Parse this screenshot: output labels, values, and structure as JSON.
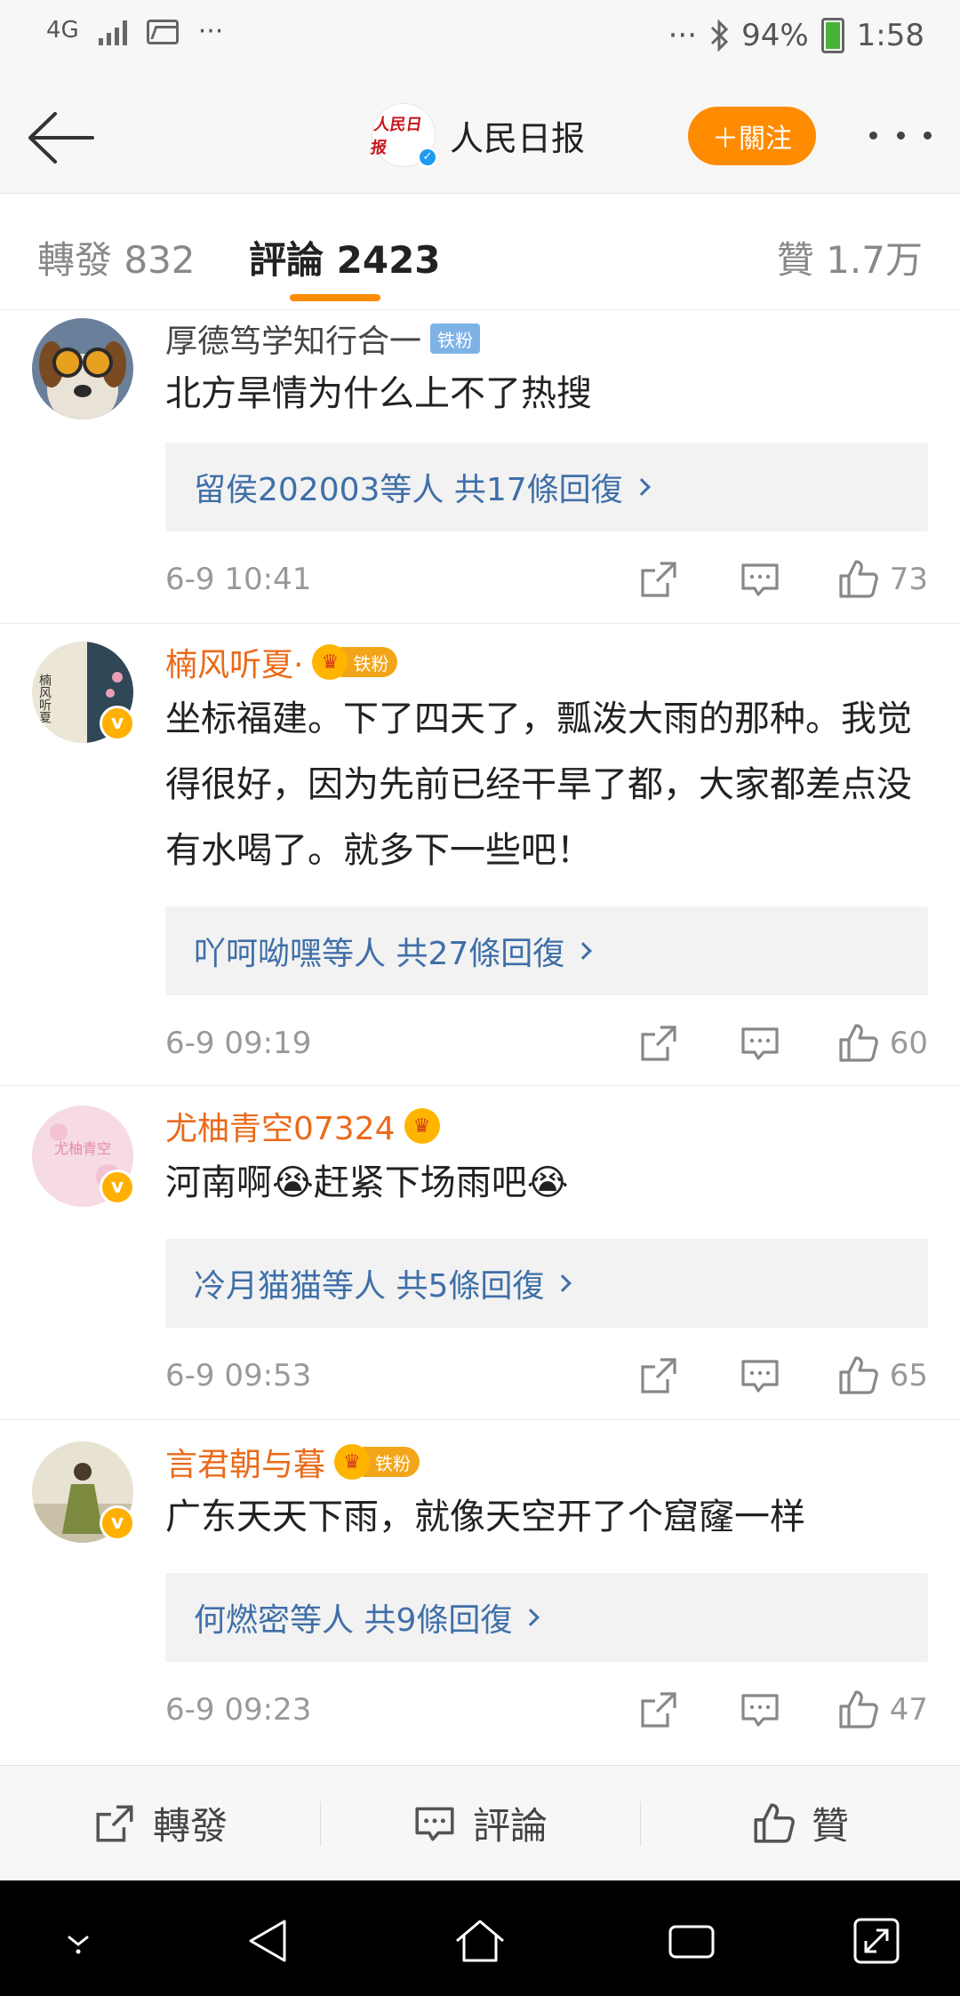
{
  "status_bar": {
    "network": "4G",
    "more_left": "···",
    "more_right": "···",
    "battery": "94%",
    "time": "1:58"
  },
  "header": {
    "account_name": "人民日报",
    "logo_text": "人民日报",
    "follow_label": "＋關注"
  },
  "tabs": {
    "repost": "轉發 832",
    "comment": "評論 2423",
    "like": "贊 1.7万"
  },
  "comments": [
    {
      "user": "厚德笃学知行合一",
      "badge": "铁粉",
      "text": "北方旱情为什么上不了热搜",
      "reply_summary": "留侯202003等人 共17條回復",
      "time": "6-9 10:41",
      "likes": "73"
    },
    {
      "user": "楠风听夏·",
      "badge": "铁粉",
      "text": "坐标福建。下了四天了，瓢泼大雨的那种。我觉得很好，因为先前已经干旱了都，大家都差点没有水喝了。就多下一些吧！",
      "reply_summary": "吖呵呦嘿等人 共27條回復",
      "time": "6-9 09:19",
      "likes": "60",
      "avatar_text": "楠风听夏"
    },
    {
      "user": "尤柚青空07324",
      "text": "河南啊😭赶紧下场雨吧😭",
      "reply_summary": "冷月猫猫等人 共5條回復",
      "time": "6-9 09:53",
      "likes": "65",
      "avatar_text": "尤柚青空"
    },
    {
      "user": "言君朝与暮",
      "badge": "铁粉",
      "text": "广东天天下雨，就像天空开了个窟窿一样",
      "reply_summary": "何燃密等人 共9條回復",
      "time": "6-9 09:23",
      "likes": "47"
    }
  ],
  "bottom_bar": {
    "repost": "轉發",
    "comment": "評論",
    "like": "贊"
  },
  "colors": {
    "accent": "#ff8b00",
    "link": "#3f6fa8",
    "vip_name": "#ea6a1a"
  }
}
